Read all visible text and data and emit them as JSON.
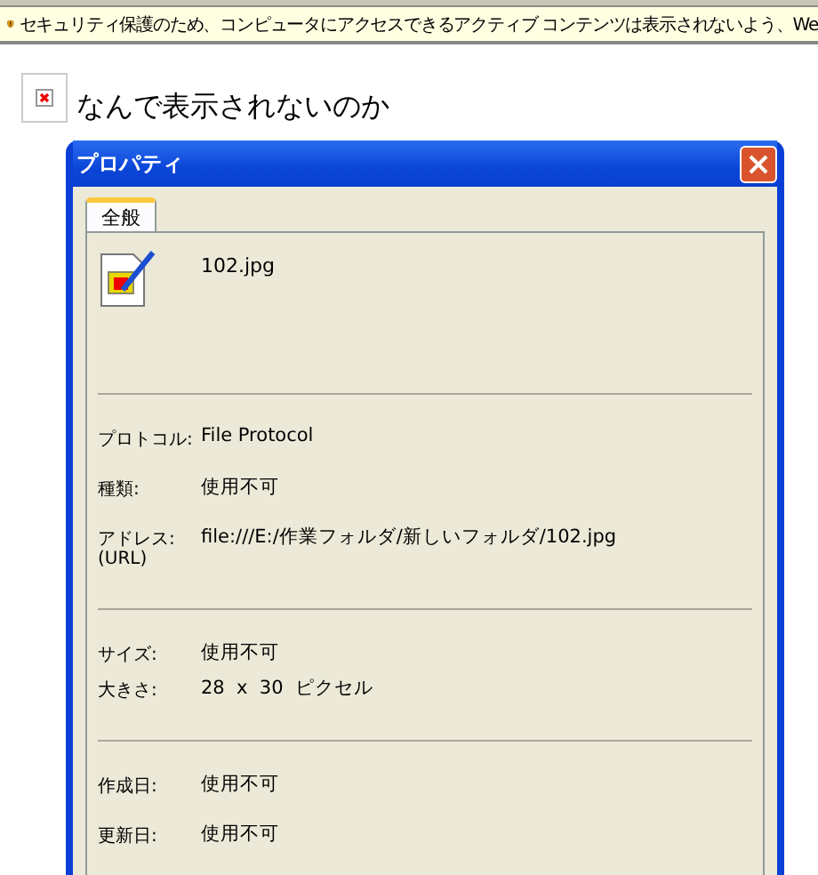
{
  "info_bar": {
    "text": "セキュリティ保護のため、コンピュータにアクセスできるアクティブ コンテンツは表示されないよう、We"
  },
  "page": {
    "heading": "なんで表示されないのか"
  },
  "dialog": {
    "title": "プロパティ",
    "tabs": [
      {
        "label": "全般",
        "selected": true
      }
    ],
    "file_name": "102.jpg",
    "sections": [
      [
        {
          "label": "プロトコル:",
          "value": "File Protocol"
        },
        {
          "label": "種類:",
          "value": "使用不可"
        },
        {
          "label": "アドレス:\n(URL)",
          "value": "file:///E:/作業フォルダ/新しいフォルダ/102.jpg"
        }
      ],
      [
        {
          "label": "サイズ:",
          "value": "使用不可"
        },
        {
          "label": "大きさ:",
          "value": "28  x  30  ピクセル"
        }
      ],
      [
        {
          "label": "作成日:",
          "value": "使用不可"
        },
        {
          "label": "更新日:",
          "value": "使用不可"
        }
      ]
    ]
  }
}
